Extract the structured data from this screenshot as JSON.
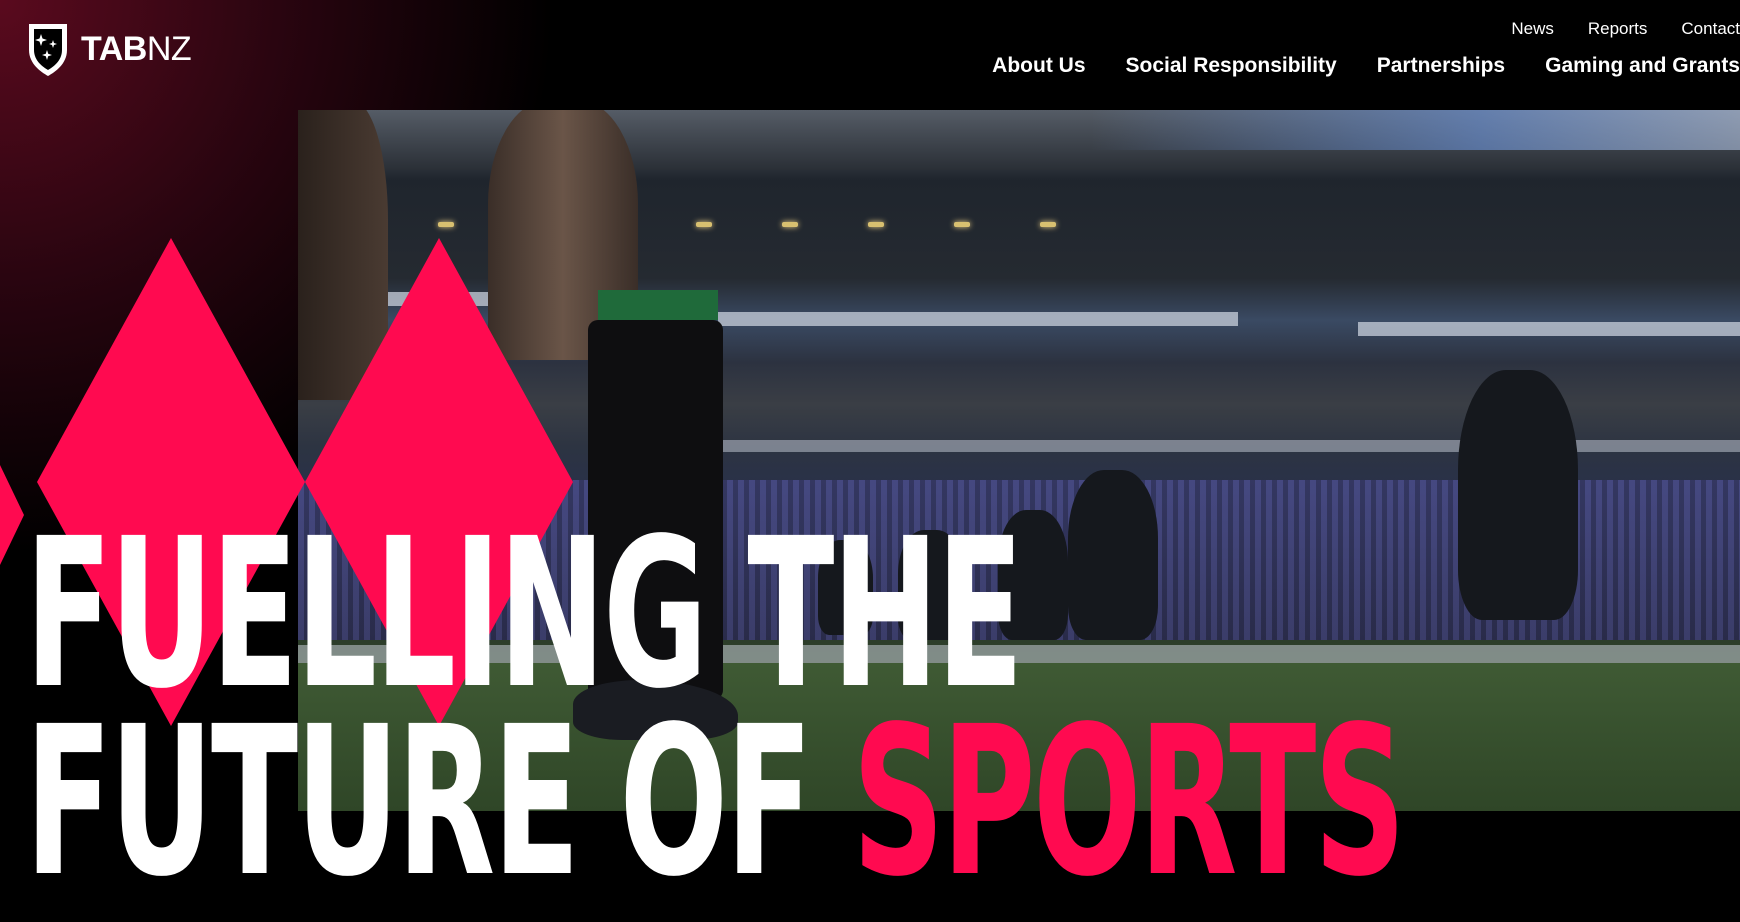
{
  "brand": {
    "name_bold": "TAB",
    "name_light": "NZ",
    "logo_icon": "shield-stars-icon"
  },
  "nav": {
    "utility": [
      "News",
      "Reports",
      "Contact"
    ],
    "main": [
      "About Us",
      "Social Responsibility",
      "Partnerships",
      "Gaming and Grants"
    ]
  },
  "hero": {
    "headline_line1": "FUELLING THE",
    "headline_line2_prefix": "FUTURE OF",
    "headline_line2_accent": "SPORTS",
    "media": "stadium-rugby-video"
  },
  "colors": {
    "accent": "#ff0a50",
    "background": "#000000",
    "text": "#ffffff"
  }
}
